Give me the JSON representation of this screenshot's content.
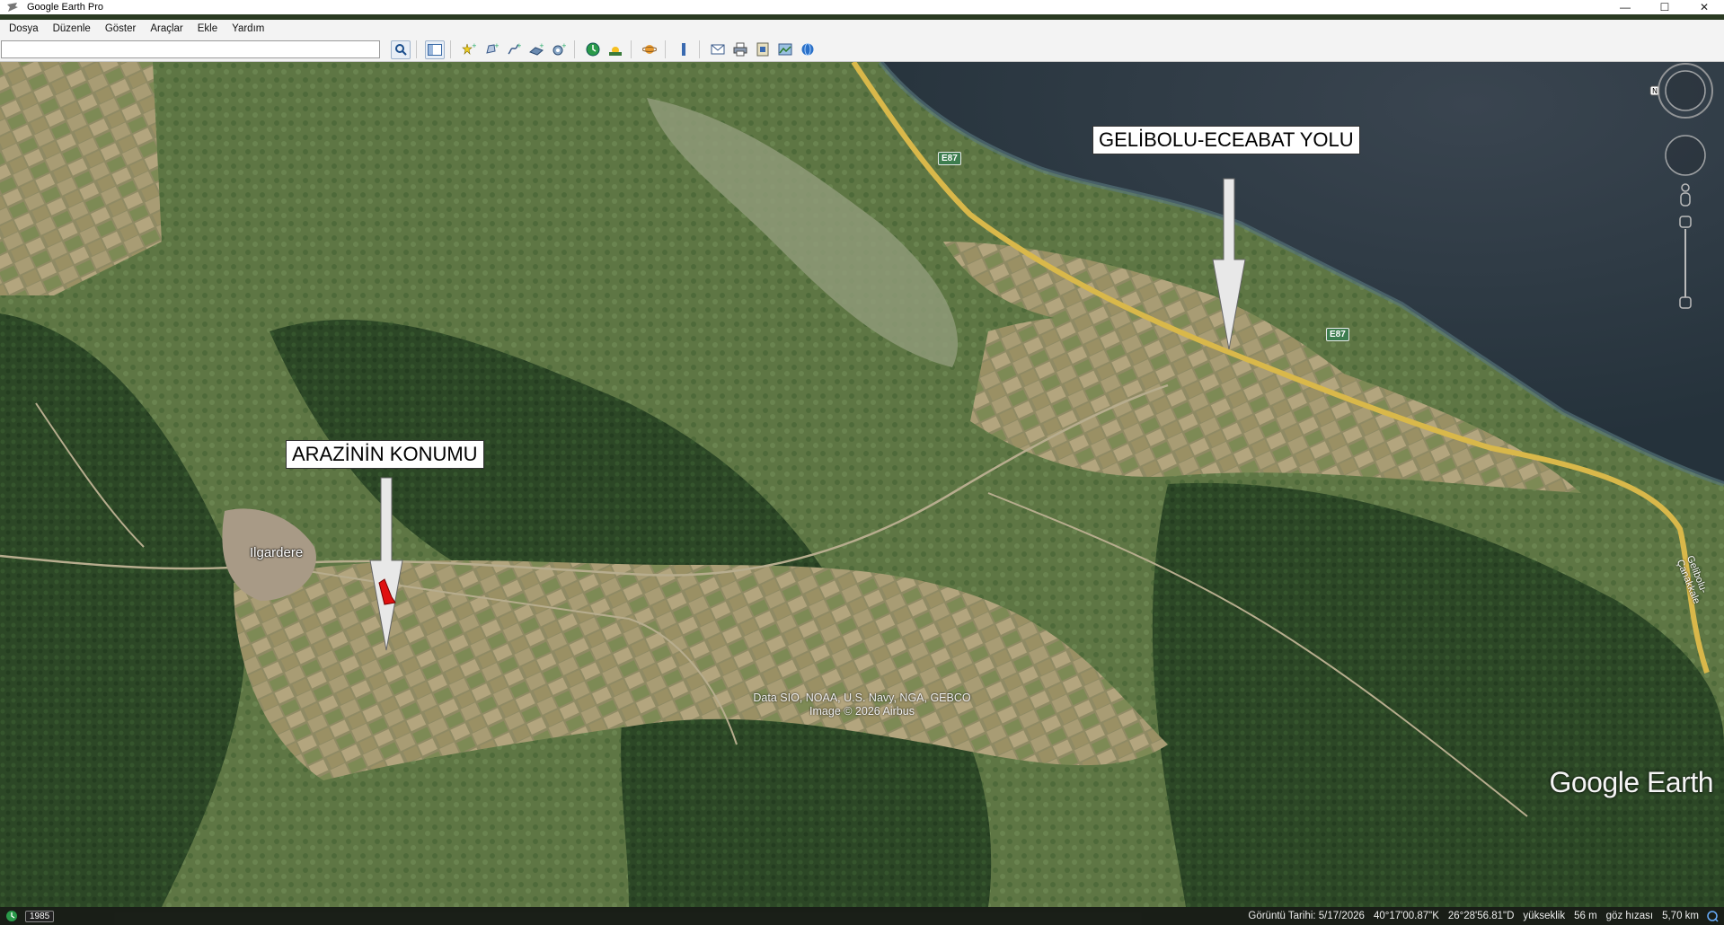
{
  "window": {
    "title": "Google Earth Pro",
    "minimize": "—",
    "maximize": "☐",
    "close": "✕"
  },
  "menu": {
    "items": [
      {
        "label": "Dosya"
      },
      {
        "label": "Düzenle"
      },
      {
        "label": "Göster"
      },
      {
        "label": "Araçlar"
      },
      {
        "label": "Ekle"
      },
      {
        "label": "Yardım"
      }
    ]
  },
  "toolbar": {
    "search_value": "",
    "icons": [
      "sidebar-icon",
      "placemark-icon",
      "polygon-icon",
      "path-icon",
      "image-overlay-icon",
      "record-tour-icon",
      "historical-imagery-icon",
      "sunlight-icon",
      "planet-icon",
      "ruler-icon",
      "email-icon",
      "print-icon",
      "save-image-icon",
      "map-view-icon",
      "web-icon"
    ]
  },
  "map": {
    "callouts": [
      {
        "text": "GELİBOLU-ECEABAT YOLU"
      },
      {
        "text": "ARAZİNİN KONUMU"
      }
    ],
    "place_label": "Ilgardere",
    "road_shields": [
      "E87",
      "E87"
    ],
    "road_name": "Gelibolu-Çanakkale",
    "attribution_line1": "Data SIO, NOAA, U.S. Navy, NGA, GEBCO",
    "attribution_line2": "Image © 2026 Airbus",
    "logo": "Google Earth"
  },
  "status": {
    "historical_year": "1985",
    "imagery_date": "Görüntü Tarihi: 5/17/2026",
    "latitude": "40°17'00.87\"K",
    "longitude": "26°28'56.81\"D",
    "elevation_label": "yükseklik",
    "elevation_value": "56 m",
    "eye_alt_label": "göz hızası",
    "eye_alt_value": "5,70 km"
  },
  "colors": {
    "forest": "#2d4a28",
    "field": "#a89a72",
    "sea": "#2e3a44",
    "road": "#e8c64a",
    "marker": "#e01010"
  }
}
